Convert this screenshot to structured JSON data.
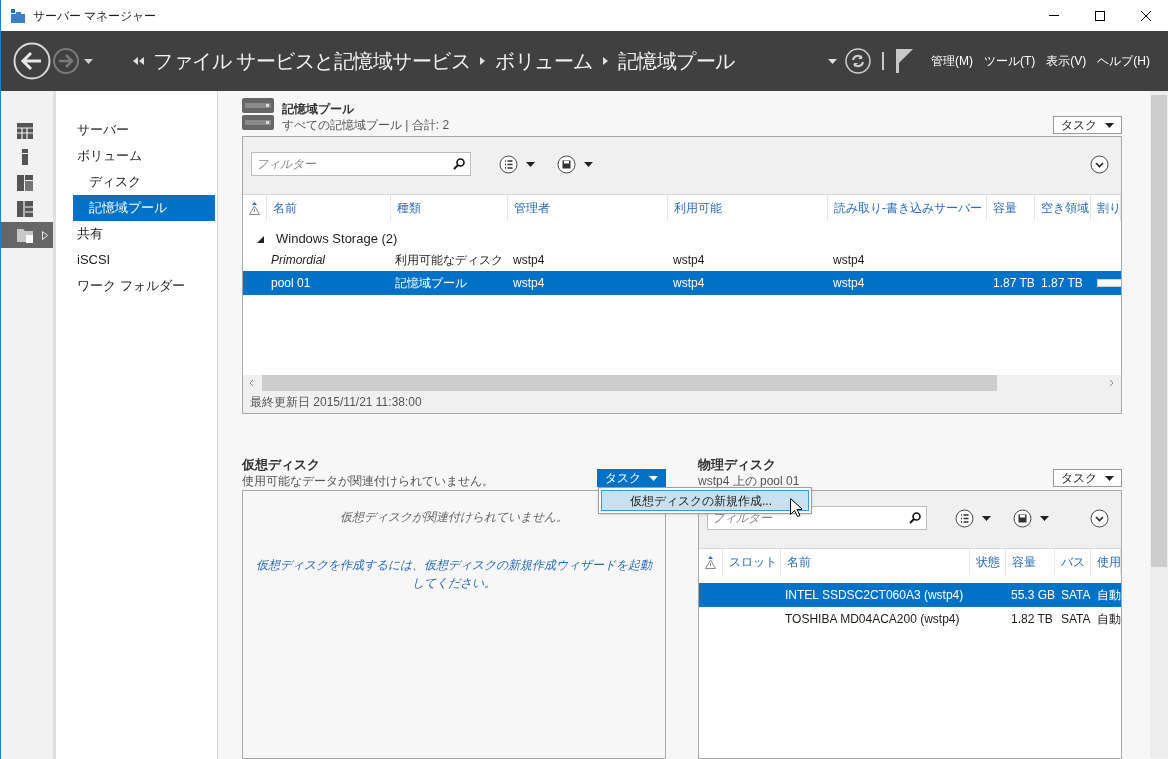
{
  "window": {
    "title": "サーバー マネージャー"
  },
  "header": {
    "breadcrumb": [
      "ファイル サービスと記憶域サービス",
      "ボリューム",
      "記憶域プール"
    ],
    "menus": [
      "管理(M)",
      "ツール(T)",
      "表示(V)",
      "ヘルプ(H)"
    ]
  },
  "rail": [
    {
      "selected": false
    },
    {
      "selected": false
    },
    {
      "selected": false
    },
    {
      "selected": false
    },
    {
      "selected": true
    }
  ],
  "nav": [
    {
      "label": "サーバー",
      "selected": false
    },
    {
      "label": "ボリューム",
      "selected": false,
      "children": [
        {
          "label": "ディスク",
          "selected": false
        },
        {
          "label": "記憶域プール",
          "selected": true
        }
      ]
    },
    {
      "label": "共有",
      "selected": false
    },
    {
      "label": "iSCSI",
      "selected": false
    },
    {
      "label": "ワーク フォルダー",
      "selected": false
    }
  ],
  "pools": {
    "title": "記憶域プール",
    "subtitle": "すべての記憶域プール | 合計: 2",
    "task_button": "タスク",
    "filter_placeholder": "フィルター",
    "columns": [
      "名前",
      "種類",
      "管理者",
      "利用可能",
      "読み取り-書き込みサーバー",
      "容量",
      "空き領域",
      "割り"
    ],
    "group": {
      "label": "Windows Storage (2)",
      "expanded": true
    },
    "rows": [
      {
        "kind": "primordial",
        "selected": false,
        "name": "Primordial",
        "type": "利用可能なディスク",
        "manager": "wstp4",
        "available": "wstp4",
        "rw_server": "wstp4"
      },
      {
        "kind": "pool",
        "selected": true,
        "name": "pool 01",
        "type": "記憶域プール",
        "manager": "wstp4",
        "available": "wstp4",
        "rw_server": "wstp4",
        "capacity": "1.87 TB",
        "free": "1.87 TB",
        "level": 1
      }
    ],
    "footer": "最終更新日 2015/11/21 11:38:00"
  },
  "virtual_disks": {
    "title": "仮想ディスク",
    "subtitle": "使用可能なデータが関連付けられていません。",
    "task_button": {
      "label": "タスク",
      "open": true
    },
    "menu": [
      {
        "label": "仮想ディスクの新規作成...",
        "selected": true
      }
    ],
    "empty_message": "仮想ディスクが関連付けられていません。",
    "hint": "仮想ディスクを作成するには、仮想ディスクの新規作成ウィザードを起動してください。"
  },
  "physical_disks": {
    "title": "物理ディスク",
    "subtitle": "wstp4 上の pool 01",
    "task_button": "タスク",
    "filter_placeholder": "フィルター",
    "columns": [
      "スロット",
      "名前",
      "状態",
      "容量",
      "バス",
      "使用"
    ],
    "rows": [
      {
        "name": "INTEL SSDSC2CT060A3 (wstp4)",
        "capacity": "55.3 GB",
        "bus": "SATA",
        "usage": "自動",
        "selected": true
      },
      {
        "name": "TOSHIBA MD04ACA200 (wstp4)",
        "capacity": "1.82 TB",
        "bus": "SATA",
        "usage": "自動",
        "selected": false
      }
    ]
  }
}
